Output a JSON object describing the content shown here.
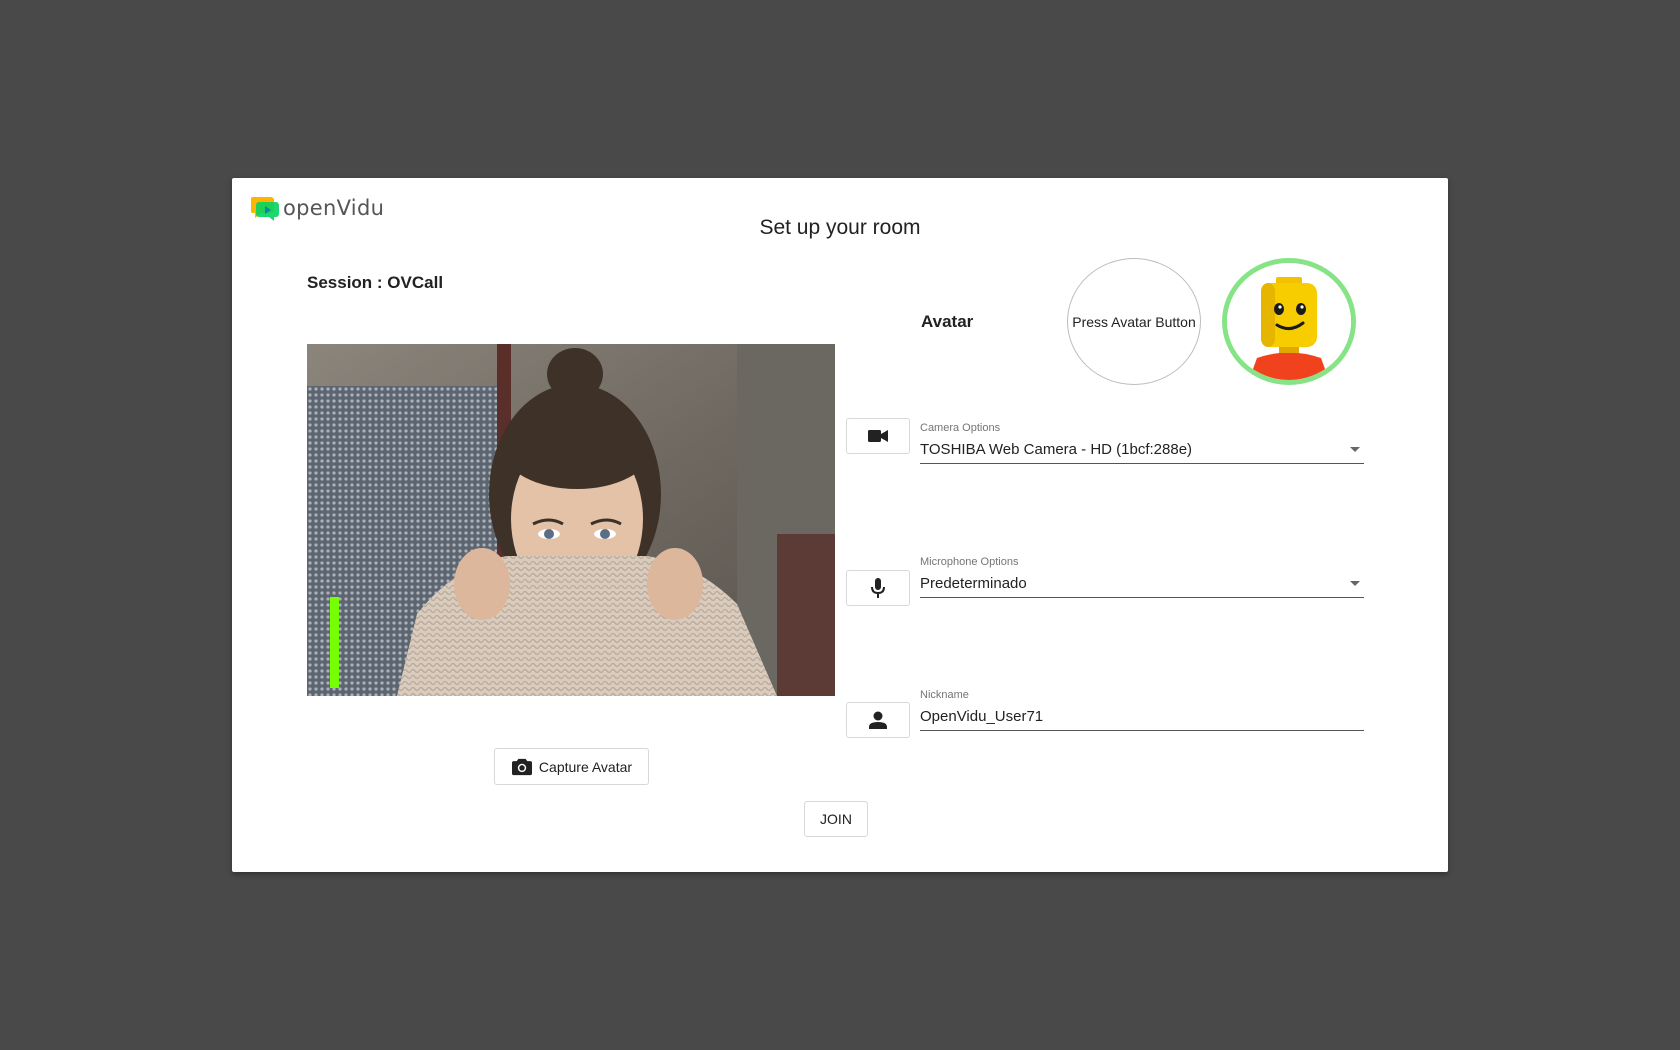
{
  "brand": {
    "logo_text": "openVidu"
  },
  "dialog": {
    "title": "Set up your room",
    "session_label": "Session : OVCall"
  },
  "video": {
    "audio_level": 0.6,
    "meter_color": "#76ff03"
  },
  "capture": {
    "label": "Capture Avatar",
    "icon": "camera-icon"
  },
  "join": {
    "label": "JOIN"
  },
  "avatar": {
    "label": "Avatar",
    "press_label": "Press Avatar Button",
    "selected_border_color": "#86e487"
  },
  "camera": {
    "label": "Camera Options",
    "value": "TOSHIBA Web Camera - HD (1bcf:288e)",
    "icon": "videocam-icon"
  },
  "microphone": {
    "label": "Microphone Options",
    "value": "Predeterminado",
    "icon": "mic-icon"
  },
  "nickname": {
    "label": "Nickname",
    "value": "OpenVidu_User71",
    "icon": "person-icon"
  }
}
